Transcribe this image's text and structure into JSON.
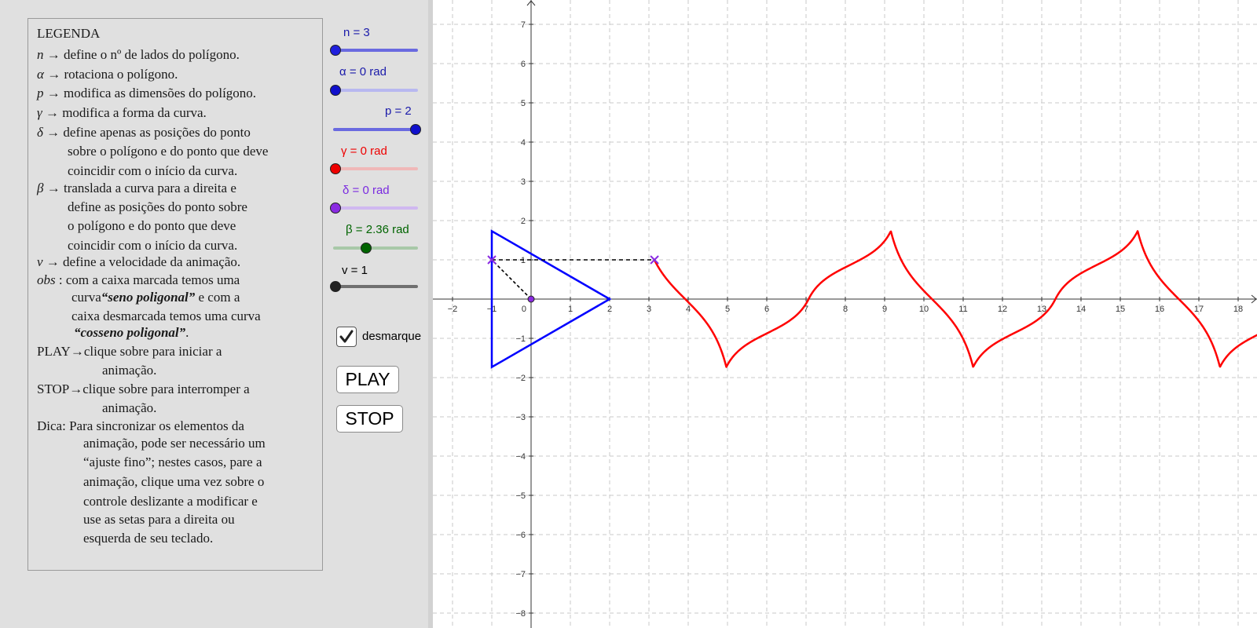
{
  "legend": {
    "title": "LEGENDA",
    "n_sym": "n",
    "n_desc": " → define o nº de lados do polígono.",
    "alpha_sym": "α",
    "alpha_desc": " → rotaciona o polígono.",
    "p_sym": "p",
    "p_desc": " → modifica as dimensões do polígono.",
    "gamma_sym": "γ",
    "gamma_desc": " → modifica a forma da curva.",
    "delta_sym": "δ",
    "delta_desc": " → define apenas as posições do ponto",
    "delta_line2": "sobre o polígono e do ponto que deve",
    "delta_line3": "coincidir com o início da curva.",
    "beta_sym": "β",
    "beta_desc": " → translada a curva para a direita e",
    "beta_line2": "define as posições do ponto sobre",
    "beta_line3": "o polígono e do ponto que deve",
    "beta_line4": "coincidir com o início da curva.",
    "v_sym": "v",
    "v_desc": " → define a velocidade da animação.",
    "obs_sym": "obs",
    "obs_desc": " : com a caixa marcada temos uma",
    "obs_line2a": "curva",
    "obs_line2b": "“seno  poligonal”",
    "obs_line2c": " e com a",
    "obs_line3": "caixa desmarcada temos uma curva",
    "obs_line4a": "“cosseno  poligonal”",
    "obs_line4b": ".",
    "play_line1": "PLAY→clique sobre para iniciar a",
    "play_line2": "animação.",
    "stop_line1": "STOP→clique sobre para interromper a",
    "stop_line2": "animação.",
    "dica_line1": "Dica: Para sincronizar os elementos da",
    "dica_line2": "animação, pode ser necessário um",
    "dica_line3": "“ajuste fino”; nestes casos, pare a",
    "dica_line4": "animação, clique uma vez sobre o",
    "dica_line5": "controle deslizante a modificar e",
    "dica_line6": "use as setas para a direita ou",
    "dica_line7": "esquerda de seu teclado."
  },
  "sliders": {
    "n": {
      "label": "n = 3",
      "value": 0.0,
      "color": "#3333cc"
    },
    "alpha": {
      "label": "α = 0 rad",
      "value": 0.0,
      "color": "#1a1acc"
    },
    "p": {
      "label": "p = 2",
      "value": 1.0,
      "color": "#1a1acc"
    },
    "gamma": {
      "label": "γ = 0 rad",
      "value": 0.0,
      "color": "#ff0000"
    },
    "delta": {
      "label": "δ = 0 rad",
      "value": 0.0,
      "color": "#8a2be2"
    },
    "beta": {
      "label": "β = 2.36 rad",
      "value": 0.38,
      "color": "#006400"
    },
    "v": {
      "label": "v = 1",
      "value": 0.0,
      "color": "#222222"
    }
  },
  "checkbox": {
    "label": "desmarque",
    "checked": true
  },
  "buttons": {
    "play": "PLAY",
    "stop": "STOP"
  },
  "graph": {
    "x_ticks": [
      "-2",
      "-1",
      "0",
      "1",
      "2",
      "3",
      "4",
      "5",
      "6",
      "7",
      "8",
      "9",
      "10",
      "11",
      "12",
      "13",
      "14",
      "15",
      "16",
      "17",
      "18"
    ],
    "y_ticks": [
      "7",
      "6",
      "5",
      "4",
      "3",
      "2",
      "1",
      "-1",
      "-2",
      "-3",
      "-4",
      "-5",
      "-6",
      "-7",
      "-8"
    ],
    "colors": {
      "polygon": "#0000ff",
      "curve": "#ff0000",
      "points": "#8a2be2",
      "grid": "#c8c8c8"
    }
  }
}
